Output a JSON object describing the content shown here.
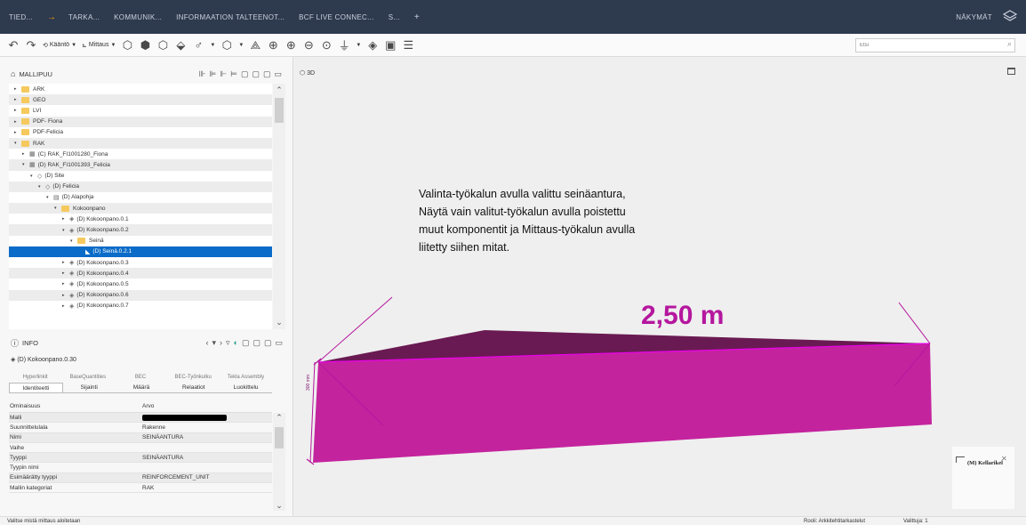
{
  "menubar": {
    "items": [
      "TIED...",
      "TARKA...",
      "KOMMUNIK...",
      "INFORMAATION TALTEENOT...",
      "BCF LIVE CONNEC...",
      "S..."
    ],
    "plus": "+",
    "right_label": "NÄKYMÄT"
  },
  "toolbar": {
    "kaanto": "Kääntö",
    "mittaus": "Mittaus",
    "search_placeholder": "Etsi"
  },
  "tree": {
    "title": "MALLIPUU",
    "rows": [
      {
        "label": "ARK",
        "type": "folder",
        "arrow": "▸",
        "indent": 0
      },
      {
        "label": "GEO",
        "type": "folder",
        "arrow": "▸",
        "indent": 0
      },
      {
        "label": "LVI",
        "type": "folder",
        "arrow": "▸",
        "indent": 0
      },
      {
        "label": "PDF- Fiona",
        "type": "folder",
        "arrow": "▸",
        "indent": 0
      },
      {
        "label": "PDF-Felicia",
        "type": "folder",
        "arrow": "▸",
        "indent": 0
      },
      {
        "label": "RAK",
        "type": "folder",
        "arrow": "▾",
        "indent": 0
      },
      {
        "label": "(C) RAK_FI1001280_Fiona",
        "type": "node",
        "icon": "▦",
        "arrow": "▸",
        "indent": 1
      },
      {
        "label": "(D) RAK_FI1001393_Felicia",
        "type": "node",
        "icon": "▦",
        "arrow": "▾",
        "indent": 1
      },
      {
        "label": "(D) Site",
        "type": "node",
        "icon": "◇",
        "arrow": "▾",
        "indent": 2
      },
      {
        "label": "(D) Felicia",
        "type": "node",
        "icon": "◇",
        "arrow": "▾",
        "indent": 3
      },
      {
        "label": "(D) Alapohja",
        "type": "node",
        "icon": "▤",
        "arrow": "▾",
        "indent": 4
      },
      {
        "label": "Kokoonpano",
        "type": "folder",
        "arrow": "▾",
        "indent": 5
      },
      {
        "label": "(D) Kokoonpano.0.1",
        "type": "node",
        "icon": "◈",
        "arrow": "▸",
        "indent": 6
      },
      {
        "label": "(D) Kokoonpano.0.2",
        "type": "node",
        "icon": "◈",
        "arrow": "▾",
        "indent": 6
      },
      {
        "label": "Seinä",
        "type": "folder",
        "arrow": "▾",
        "indent": 7
      },
      {
        "label": "(D) Seinä.0.2.1",
        "type": "node",
        "icon": "◣",
        "arrow": "",
        "indent": 8,
        "selected": true
      },
      {
        "label": "(D) Kokoonpano.0.3",
        "type": "node",
        "icon": "◈",
        "arrow": "▸",
        "indent": 6
      },
      {
        "label": "(D) Kokoonpano.0.4",
        "type": "node",
        "icon": "◈",
        "arrow": "▸",
        "indent": 6
      },
      {
        "label": "(D) Kokoonpano.0.5",
        "type": "node",
        "icon": "◈",
        "arrow": "▸",
        "indent": 6
      },
      {
        "label": "(D) Kokoonpano.0.6",
        "type": "node",
        "icon": "◈",
        "arrow": "▸",
        "indent": 6
      },
      {
        "label": "(D) Kokoonpano.0.7",
        "type": "node",
        "icon": "◈",
        "arrow": "▸",
        "indent": 6
      }
    ]
  },
  "info": {
    "title": "INFO",
    "subtitle": "(D) Kokoonpano.0.30",
    "tabs_top": [
      "Hyperlinkit",
      "BaseQuantities",
      "BEC",
      "BEC-Työnkulku",
      "Tekla Assembly"
    ],
    "tabs_bottom": [
      "Identiteetti",
      "Sijainti",
      "Määrä",
      "Relaatiot",
      "Luokittelu"
    ],
    "active_tab": "Identiteetti",
    "col_key": "Ominaisuus",
    "col_val": "Arvo",
    "rows": [
      {
        "key": "Malli",
        "value": "",
        "redacted": true
      },
      {
        "key": "Suunnittelulala",
        "value": "Rakenne"
      },
      {
        "key": "Nimi",
        "value": "SEINÄANTURA"
      },
      {
        "key": "Vaihe",
        "value": ""
      },
      {
        "key": "Tyyppi",
        "value": "SEINÄANTURA"
      },
      {
        "key": "Tyypin nimi",
        "value": ""
      },
      {
        "key": "Esimäärätty tyyppi",
        "value": "REINFORCEMENT_UNIT"
      },
      {
        "key": "Mallin kategoriat",
        "value": "RAK"
      }
    ]
  },
  "viewport": {
    "label": "3D",
    "annotation": [
      "Valinta-työkalun avulla valittu seinäantura,",
      "Näytä vain valitut-työkalun avulla poistettu",
      "muut komponentit ja Mittaus-työkalun avulla",
      "liitetty siihen mitat."
    ],
    "dimension": "2,50 m",
    "height_dimension": "300 mm",
    "navcube_label": "(M) Kellarikel"
  },
  "status": {
    "left": "Valitse mistä mittaus aloitetaan",
    "role": "Rooli: Arkkitehtitarkastelut",
    "selected": "Valittuja: 1"
  },
  "colors": {
    "magenta_front": "#c4239e",
    "magenta_top": "#6a1a52",
    "dimension": "#b5179e"
  }
}
